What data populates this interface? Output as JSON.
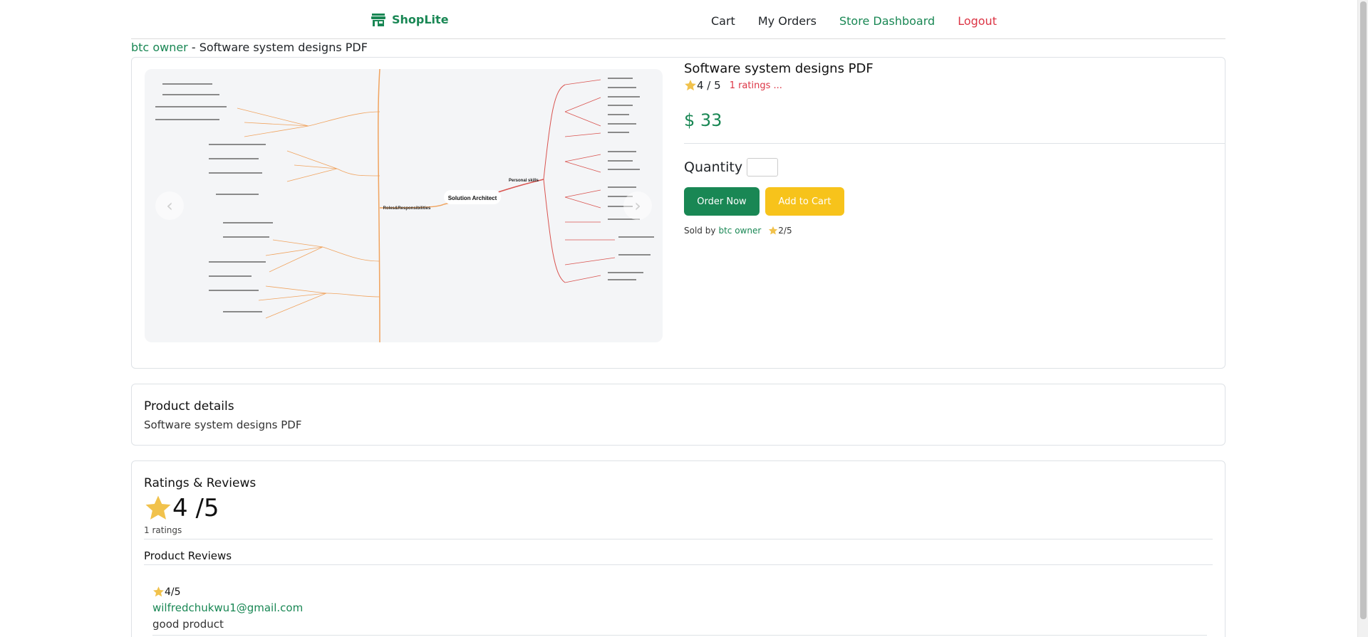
{
  "nav": {
    "brand": "ShopLite",
    "links": [
      "Cart",
      "My Orders",
      "Store Dashboard",
      "Logout"
    ]
  },
  "breadcrumb": {
    "owner": "btc owner",
    "separator": " - ",
    "product": "Software system designs PDF"
  },
  "product": {
    "title": "Software system designs PDF",
    "rating": "4 / 5",
    "ratings_link": "1 ratings ...",
    "price": "$ 33",
    "quantity_label": "Quantity",
    "quantity_value": "",
    "order_button": "Order Now",
    "cart_button": "Add to Cart",
    "sold_by_label": "Sold by",
    "seller": "btc owner",
    "seller_rating": "2/5",
    "image_caption_center": "Solution Architect",
    "image_caption_left": "Roles&Responsibilities",
    "image_caption_right": "Personal skills"
  },
  "details": {
    "title": "Product details",
    "text": "Software system designs PDF"
  },
  "ratings": {
    "title": "Ratings & Reviews",
    "score": "4 /5",
    "count": "1 ratings",
    "reviews_title": "Product Reviews",
    "reviews": [
      {
        "score": "4/5",
        "email": "wilfredchukwu1@gmail.com",
        "text": "good product"
      }
    ]
  },
  "colors": {
    "primary_green": "#198754",
    "logout_red": "#dc3545",
    "cart_yellow": "#f7c31b",
    "star_gold": "#f1c24c"
  }
}
